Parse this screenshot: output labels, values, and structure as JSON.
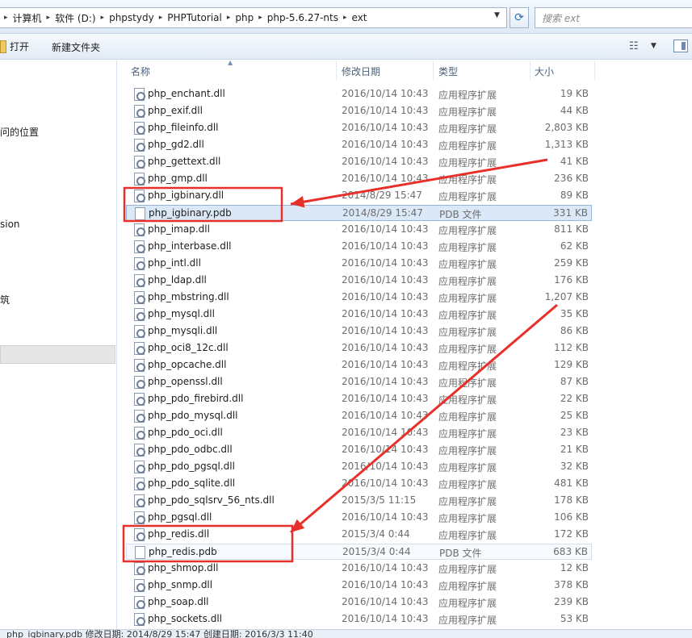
{
  "address": {
    "crumbs": [
      "计算机",
      "软件 (D:)",
      "phpstydy",
      "PHPTutorial",
      "php",
      "php-5.6.27-nts",
      "ext"
    ],
    "search_placeholder": "搜索 ext"
  },
  "toolbar": {
    "open_label": "打开",
    "new_folder_label": "新建文件夹"
  },
  "nav": {
    "item_recent": "问的位置",
    "item_version": "sion",
    "item_cn": "筑"
  },
  "columns": {
    "name": "名称",
    "date": "修改日期",
    "type": "类型",
    "size": "大小"
  },
  "files": [
    {
      "name": "php_enchant.dll",
      "date": "2016/10/14 10:43",
      "type": "应用程序扩展",
      "size": "19 KB",
      "icon": "dll-icon"
    },
    {
      "name": "php_exif.dll",
      "date": "2016/10/14 10:43",
      "type": "应用程序扩展",
      "size": "44 KB",
      "icon": "dll-icon"
    },
    {
      "name": "php_fileinfo.dll",
      "date": "2016/10/14 10:43",
      "type": "应用程序扩展",
      "size": "2,803 KB",
      "icon": "dll-icon"
    },
    {
      "name": "php_gd2.dll",
      "date": "2016/10/14 10:43",
      "type": "应用程序扩展",
      "size": "1,313 KB",
      "icon": "dll-icon"
    },
    {
      "name": "php_gettext.dll",
      "date": "2016/10/14 10:43",
      "type": "应用程序扩展",
      "size": "41 KB",
      "icon": "dll-icon"
    },
    {
      "name": "php_gmp.dll",
      "date": "2016/10/14 10:43",
      "type": "应用程序扩展",
      "size": "236 KB",
      "icon": "dll-icon"
    },
    {
      "name": "php_igbinary.dll",
      "date": "2014/8/29 15:47",
      "type": "应用程序扩展",
      "size": "89 KB",
      "icon": "dll-icon"
    },
    {
      "name": "php_igbinary.pdb",
      "date": "2014/8/29 15:47",
      "type": "PDB 文件",
      "size": "331 KB",
      "icon": "file-icon",
      "state": "selected"
    },
    {
      "name": "php_imap.dll",
      "date": "2016/10/14 10:43",
      "type": "应用程序扩展",
      "size": "811 KB",
      "icon": "dll-icon"
    },
    {
      "name": "php_interbase.dll",
      "date": "2016/10/14 10:43",
      "type": "应用程序扩展",
      "size": "62 KB",
      "icon": "dll-icon"
    },
    {
      "name": "php_intl.dll",
      "date": "2016/10/14 10:43",
      "type": "应用程序扩展",
      "size": "259 KB",
      "icon": "dll-icon"
    },
    {
      "name": "php_ldap.dll",
      "date": "2016/10/14 10:43",
      "type": "应用程序扩展",
      "size": "176 KB",
      "icon": "dll-icon"
    },
    {
      "name": "php_mbstring.dll",
      "date": "2016/10/14 10:43",
      "type": "应用程序扩展",
      "size": "1,207 KB",
      "icon": "dll-icon"
    },
    {
      "name": "php_mysql.dll",
      "date": "2016/10/14 10:43",
      "type": "应用程序扩展",
      "size": "35 KB",
      "icon": "dll-icon"
    },
    {
      "name": "php_mysqli.dll",
      "date": "2016/10/14 10:43",
      "type": "应用程序扩展",
      "size": "86 KB",
      "icon": "dll-icon"
    },
    {
      "name": "php_oci8_12c.dll",
      "date": "2016/10/14 10:43",
      "type": "应用程序扩展",
      "size": "112 KB",
      "icon": "dll-icon"
    },
    {
      "name": "php_opcache.dll",
      "date": "2016/10/14 10:43",
      "type": "应用程序扩展",
      "size": "129 KB",
      "icon": "dll-icon"
    },
    {
      "name": "php_openssl.dll",
      "date": "2016/10/14 10:43",
      "type": "应用程序扩展",
      "size": "87 KB",
      "icon": "dll-icon"
    },
    {
      "name": "php_pdo_firebird.dll",
      "date": "2016/10/14 10:43",
      "type": "应用程序扩展",
      "size": "22 KB",
      "icon": "dll-icon"
    },
    {
      "name": "php_pdo_mysql.dll",
      "date": "2016/10/14 10:43",
      "type": "应用程序扩展",
      "size": "25 KB",
      "icon": "dll-icon"
    },
    {
      "name": "php_pdo_oci.dll",
      "date": "2016/10/14 10:43",
      "type": "应用程序扩展",
      "size": "23 KB",
      "icon": "dll-icon"
    },
    {
      "name": "php_pdo_odbc.dll",
      "date": "2016/10/14 10:43",
      "type": "应用程序扩展",
      "size": "21 KB",
      "icon": "dll-icon"
    },
    {
      "name": "php_pdo_pgsql.dll",
      "date": "2016/10/14 10:43",
      "type": "应用程序扩展",
      "size": "32 KB",
      "icon": "dll-icon"
    },
    {
      "name": "php_pdo_sqlite.dll",
      "date": "2016/10/14 10:43",
      "type": "应用程序扩展",
      "size": "481 KB",
      "icon": "dll-icon"
    },
    {
      "name": "php_pdo_sqlsrv_56_nts.dll",
      "date": "2015/3/5 11:15",
      "type": "应用程序扩展",
      "size": "178 KB",
      "icon": "dll-icon"
    },
    {
      "name": "php_pgsql.dll",
      "date": "2016/10/14 10:43",
      "type": "应用程序扩展",
      "size": "106 KB",
      "icon": "dll-icon"
    },
    {
      "name": "php_redis.dll",
      "date": "2015/3/4 0:44",
      "type": "应用程序扩展",
      "size": "172 KB",
      "icon": "dll-icon"
    },
    {
      "name": "php_redis.pdb",
      "date": "2015/3/4 0:44",
      "type": "PDB 文件",
      "size": "683 KB",
      "icon": "file-icon",
      "state": "hover"
    },
    {
      "name": "php_shmop.dll",
      "date": "2016/10/14 10:43",
      "type": "应用程序扩展",
      "size": "12 KB",
      "icon": "dll-icon"
    },
    {
      "name": "php_snmp.dll",
      "date": "2016/10/14 10:43",
      "type": "应用程序扩展",
      "size": "378 KB",
      "icon": "dll-icon"
    },
    {
      "name": "php_soap.dll",
      "date": "2016/10/14 10:43",
      "type": "应用程序扩展",
      "size": "239 KB",
      "icon": "dll-icon"
    },
    {
      "name": "php_sockets.dll",
      "date": "2016/10/14 10:43",
      "type": "应用程序扩展",
      "size": "53 KB",
      "icon": "dll-icon"
    }
  ],
  "status": {
    "text": "php_igbinary.pdb  修改日期: 2014/8/29 15:47     创建日期: 2016/3/3 11:40"
  },
  "colors": {
    "annotation": "#e8302a",
    "selection_bg": "#dbe8f8",
    "selection_border": "#96b4dc"
  }
}
